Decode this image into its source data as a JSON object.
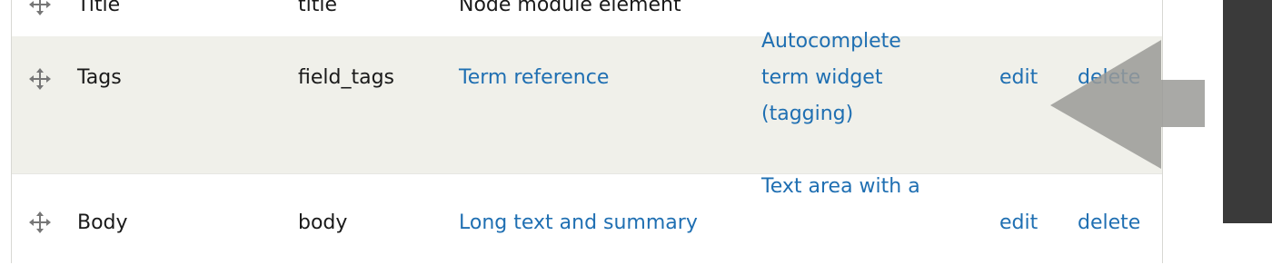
{
  "rows": [
    {
      "label": "Title",
      "machine_name": "title",
      "field_type": "Node module element",
      "widget_lines": [],
      "edit": "",
      "delete": ""
    },
    {
      "label": "Tags",
      "machine_name": "field_tags",
      "field_type": "Term reference",
      "widget_lines": [
        "Autocomplete",
        "term widget",
        "(tagging)"
      ],
      "edit": "edit",
      "delete": "delete"
    },
    {
      "label": "Body",
      "machine_name": "body",
      "field_type": "Long text and summary",
      "widget_lines": [
        "Text area with a"
      ],
      "edit": "edit",
      "delete": "delete"
    }
  ],
  "colors": {
    "link": "#1f6fb2",
    "selected_row": "#f0f0ea",
    "callout_arrow": "#9a9a96",
    "right_bar": "#3a3a3a"
  },
  "icons": {
    "row_handle": "drag-handle-icon",
    "callout": "pointer-arrow-icon"
  }
}
